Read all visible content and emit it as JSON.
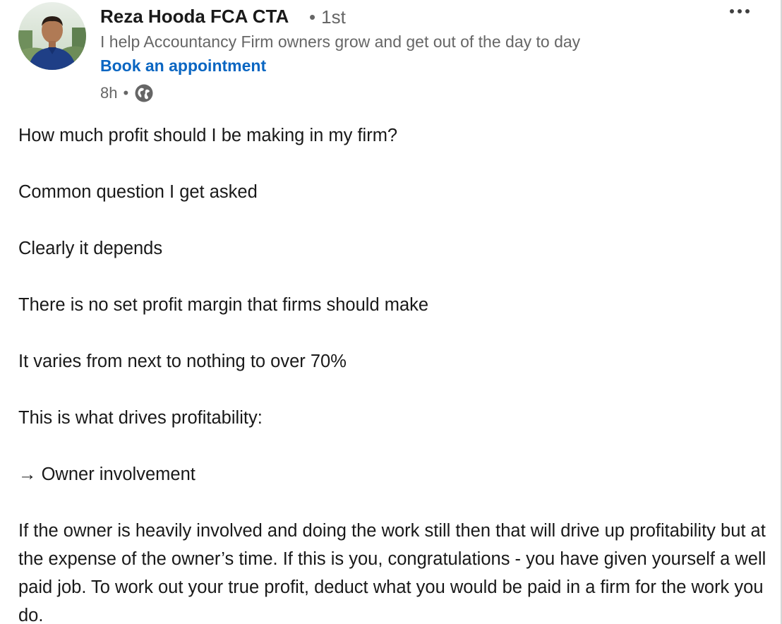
{
  "post": {
    "author": {
      "name": "Reza Hooda FCA CTA",
      "degree_separator": "•",
      "degree": "1st",
      "headline": "I help Accountancy Firm owners grow and get out of the day to day",
      "cta_link": "Book an appointment",
      "avatar_icon": "profile-photo"
    },
    "meta": {
      "time": "8h",
      "separator": "•",
      "visibility_icon": "globe-icon"
    },
    "more_button_icon": "ellipsis-icon",
    "paragraphs": [
      "How much profit should I be making in my firm?",
      "Common question I get asked",
      "Clearly it depends",
      "There is no set profit margin that firms should make",
      "It varies from next to nothing to over 70%",
      "This is what drives profitability:",
      "→ Owner involvement",
      "If the owner is heavily involved and doing the work still then that will drive up profitability but at the expense of the owner’s time. If this is you, congratulations - you have given yourself a well paid job. To work out your true profit, deduct what you would be paid in a firm for the work you do."
    ]
  },
  "colors": {
    "link": "#0a66c2",
    "text": "#191919",
    "secondary": "#666666"
  }
}
